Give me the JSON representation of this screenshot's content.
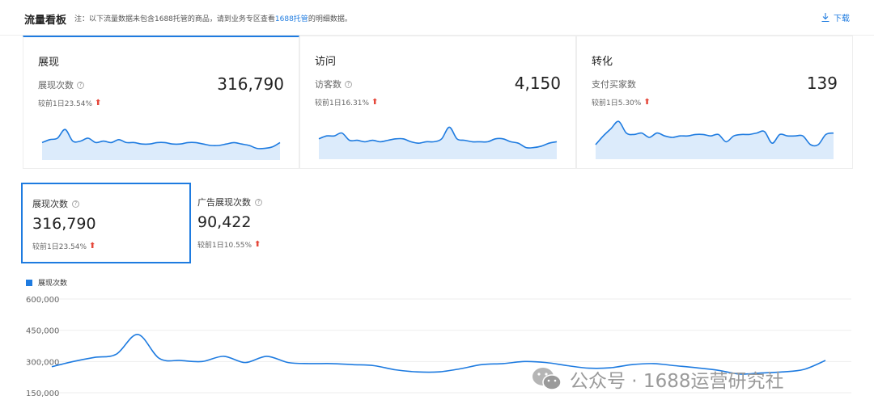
{
  "header": {
    "title": "流量看板",
    "note_prefix": "注：以下流量数据未包含1688托管的商品，请到业务专区查看",
    "note_link": "1688托管",
    "note_suffix": "的明细数据。",
    "download_label": "下载"
  },
  "cards": [
    {
      "name": "展现",
      "label": "展现次数",
      "value": "316,790",
      "compare": "较前1日23.54%",
      "spark": [
        12,
        14,
        15,
        21,
        13,
        13,
        15,
        12,
        13,
        12,
        14,
        12,
        12,
        11,
        11,
        12,
        12,
        11,
        11,
        12,
        12,
        11,
        10,
        10,
        11,
        12,
        11,
        10,
        8,
        8,
        9,
        12
      ]
    },
    {
      "name": "访问",
      "label": "访客数",
      "value": "4,150",
      "compare": "较前1日16.31%",
      "spark": [
        14,
        16,
        16,
        18,
        13,
        13,
        12,
        13,
        12,
        13,
        14,
        14,
        12,
        11,
        12,
        12,
        14,
        22,
        14,
        13,
        12,
        12,
        12,
        14,
        14,
        12,
        11,
        8,
        8,
        9,
        11,
        12
      ]
    },
    {
      "name": "转化",
      "label": "支付买家数",
      "value": "139",
      "compare": "较前1日5.30%",
      "spark": [
        10,
        16,
        21,
        26,
        18,
        17,
        18,
        15,
        18,
        16,
        15,
        16,
        16,
        17,
        17,
        16,
        17,
        12,
        16,
        17,
        17,
        18,
        19,
        11,
        17,
        16,
        16,
        16,
        10,
        10,
        17,
        18
      ]
    }
  ],
  "subs": [
    {
      "label": "展现次数",
      "value": "316,790",
      "compare": "较前1日23.54%"
    },
    {
      "label": "广告展现次数",
      "value": "90,422",
      "compare": "较前1日10.55%"
    }
  ],
  "chart_data": {
    "type": "line",
    "series": [
      {
        "name": "展现次数",
        "values": [
          275000,
          300000,
          320000,
          335000,
          430000,
          315000,
          305000,
          300000,
          325000,
          295000,
          325000,
          295000,
          290000,
          290000,
          285000,
          280000,
          260000,
          250000,
          250000,
          265000,
          285000,
          290000,
          300000,
          295000,
          280000,
          268000,
          270000,
          285000,
          290000,
          280000,
          270000,
          258000,
          240000,
          245000,
          250000,
          262000,
          305000
        ]
      }
    ],
    "yticks": [
      "600,000",
      "450,000",
      "300,000",
      "150,000"
    ],
    "ylim": [
      150000,
      600000
    ]
  },
  "watermark": "公众号 · 1688运营研究社",
  "colors": {
    "accent": "#1e7be0",
    "up_arrow": "#e5483b",
    "area_fill": "#dcebfb"
  }
}
